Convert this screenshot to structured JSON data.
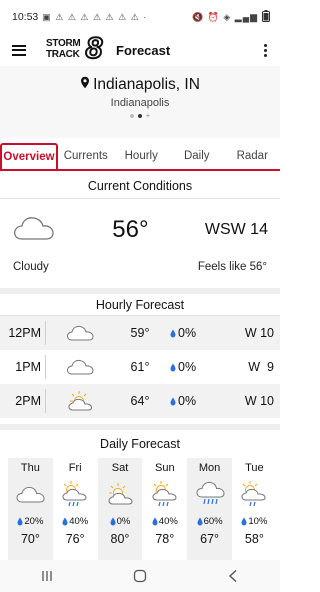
{
  "status_bar": {
    "time": "10:53",
    "battery": ""
  },
  "app_bar": {
    "logo_text_1": "STORM",
    "logo_text_2": "TRACK",
    "logo_number": "8",
    "title": "Forecast"
  },
  "location": {
    "name": "Indianapolis, IN",
    "sub": "Indianapolis",
    "pager": {
      "total": 2,
      "current": 2
    }
  },
  "tabs": [
    "Overview",
    "Currents",
    "Hourly",
    "Daily",
    "Radar"
  ],
  "current_conditions": {
    "title": "Current Conditions",
    "temp": "56°",
    "wind": "WSW 14",
    "condition": "Cloudy",
    "feels_like": "Feels like 56°",
    "icon": "cloud-icon"
  },
  "hourly": {
    "title": "Hourly Forecast",
    "rows": [
      {
        "time": "12PM",
        "icon": "cloud-icon",
        "temp": "59°",
        "precip": "0%",
        "wind": "W 10"
      },
      {
        "time": "1PM",
        "icon": "cloud-icon",
        "temp": "61°",
        "precip": "0%",
        "wind": "W  9"
      },
      {
        "time": "2PM",
        "icon": "partly-cloudy-icon",
        "temp": "64°",
        "precip": "0%",
        "wind": "W 10"
      }
    ]
  },
  "daily": {
    "title": "Daily Forecast",
    "days": [
      {
        "day": "Thu",
        "icon": "cloud-icon",
        "precip": "20%",
        "temp": "70°"
      },
      {
        "day": "Fri",
        "icon": "sun-rain-icon",
        "precip": "40%",
        "temp": "76°"
      },
      {
        "day": "Sat",
        "icon": "partly-cloudy-icon",
        "precip": "0%",
        "temp": "80°"
      },
      {
        "day": "Sun",
        "icon": "sun-rain-icon",
        "precip": "40%",
        "temp": "78°"
      },
      {
        "day": "Mon",
        "icon": "rain-icon",
        "precip": "60%",
        "temp": "67°"
      },
      {
        "day": "Tue",
        "icon": "sun-rain-icon",
        "precip": "10%",
        "temp": "58°"
      }
    ]
  },
  "colors": {
    "accent": "#c8102e",
    "drop": "#2a6fdb",
    "sun": "#f0a818"
  }
}
